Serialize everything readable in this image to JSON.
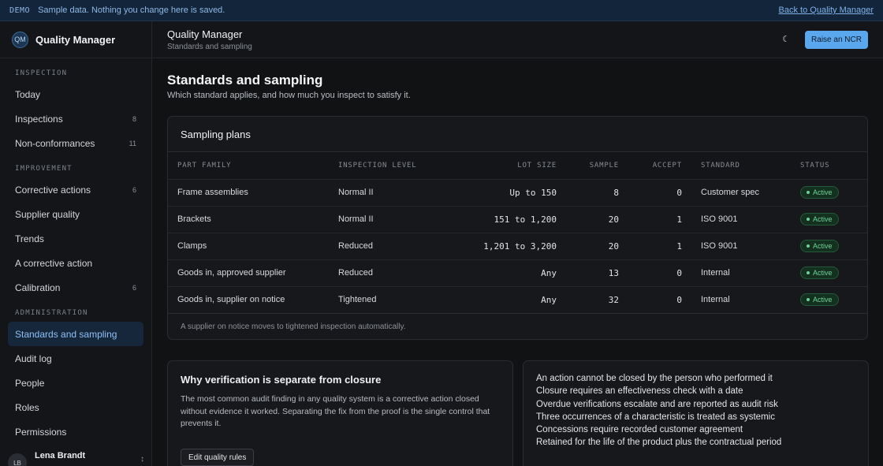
{
  "banner": {
    "tag": "DEMO",
    "message": "Sample data. Nothing you change here is saved.",
    "back_link": "Back to Quality Manager"
  },
  "brand": {
    "initials": "QM",
    "name": "Quality Manager"
  },
  "sidebar": {
    "sections": [
      {
        "title": "INSPECTION",
        "items": [
          {
            "label": "Today",
            "count": ""
          },
          {
            "label": "Inspections",
            "count": "8"
          },
          {
            "label": "Non-conformances",
            "count": "11"
          }
        ]
      },
      {
        "title": "IMPROVEMENT",
        "items": [
          {
            "label": "Corrective actions",
            "count": "6"
          },
          {
            "label": "Supplier quality",
            "count": ""
          },
          {
            "label": "Trends",
            "count": ""
          },
          {
            "label": "A corrective action",
            "count": ""
          },
          {
            "label": "Calibration",
            "count": "6"
          }
        ]
      },
      {
        "title": "ADMINISTRATION",
        "items": [
          {
            "label": "Standards and sampling",
            "count": "",
            "active": true
          },
          {
            "label": "Audit log",
            "count": ""
          },
          {
            "label": "People",
            "count": ""
          },
          {
            "label": "Roles",
            "count": ""
          },
          {
            "label": "Permissions",
            "count": ""
          }
        ]
      }
    ]
  },
  "user": {
    "initials": "LB",
    "name": "Lena Brandt",
    "collapse_icon": "collapse-icon"
  },
  "header": {
    "title": "Quality Manager",
    "subtitle": "Standards and sampling",
    "theme_icon": "moon-icon",
    "primary_button": "Raise an NCR"
  },
  "page": {
    "title": "Standards and sampling",
    "subtitle": "Which standard applies, and how much you inspect to satisfy it."
  },
  "plans": {
    "title": "Sampling plans",
    "columns": [
      "PART FAMILY",
      "INSPECTION LEVEL",
      "LOT SIZE",
      "SAMPLE",
      "ACCEPT",
      "STANDARD",
      "STATUS"
    ],
    "rows": [
      {
        "part": "Frame assemblies",
        "level": "Normal II",
        "lot": "Up to 150",
        "sample": "8",
        "accept": "0",
        "standard": "Customer spec",
        "status": "Active"
      },
      {
        "part": "Brackets",
        "level": "Normal II",
        "lot": "151 to 1,200",
        "sample": "20",
        "accept": "1",
        "standard": "ISO 9001",
        "status": "Active"
      },
      {
        "part": "Clamps",
        "level": "Reduced",
        "lot": "1,201 to 3,200",
        "sample": "20",
        "accept": "1",
        "standard": "ISO 9001",
        "status": "Active"
      },
      {
        "part": "Goods in, approved supplier",
        "level": "Reduced",
        "lot": "Any",
        "sample": "13",
        "accept": "0",
        "standard": "Internal",
        "status": "Active"
      },
      {
        "part": "Goods in, supplier on notice",
        "level": "Tightened",
        "lot": "Any",
        "sample": "32",
        "accept": "0",
        "standard": "Internal",
        "status": "Active"
      }
    ],
    "footnote": "A supplier on notice moves to tightened inspection automatically.",
    "status_color": "#6fd39a"
  },
  "why": {
    "title": "Why verification is separate from closure",
    "body": "The most common audit finding in any quality system is a corrective action closed without evidence it worked. Separating the fix from the proof is the single control that prevents it.",
    "button": "Edit quality rules"
  },
  "rules": [
    "An action cannot be closed by the person who performed it",
    "Closure requires an effectiveness check with a date",
    "Overdue verifications escalate and are reported as audit risk",
    "Three occurrences of a characteristic is treated as systemic",
    "Concessions require recorded customer agreement",
    "Retained for the life of the product plus the contractual period"
  ],
  "colors": {
    "accent": "#5aa7ee",
    "banner_bg": "#13253a",
    "active_nav": "#8ec0f4"
  }
}
